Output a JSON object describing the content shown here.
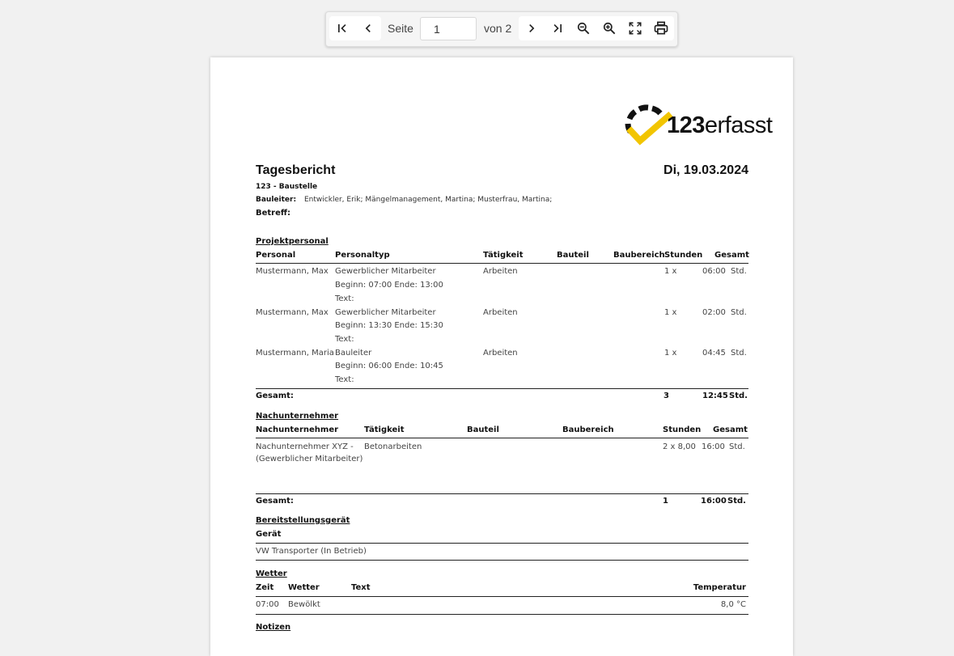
{
  "toolbar": {
    "page_label": "Seite",
    "page_value": "1",
    "of_label": "von 2",
    "icons": [
      "first-page-icon",
      "prev-page-icon",
      "next-page-icon",
      "last-page-icon",
      "zoom-out-icon",
      "zoom-in-icon",
      "fullscreen-icon",
      "print-icon"
    ]
  },
  "report": {
    "logo_text_bold": "123",
    "logo_text_rest": "erfasst",
    "logo_colors": {
      "ring": "#111111",
      "check": "#f2c500"
    },
    "title": "Tagesbericht",
    "date": "Di, 19.03.2024",
    "site": "123 - Baustelle",
    "manager_label": "Bauleiter:",
    "manager_value": "Entwickler, Erik; Mängelmanagement, Martina; Musterfrau, Martina;",
    "subject_label": "Betreff:"
  },
  "personnel": {
    "section": "Projektpersonal",
    "headers": {
      "name": "Personal",
      "type": "Personaltyp",
      "activity": "Tätigkeit",
      "part": "Bauteil",
      "area": "Baubereich",
      "hours": "Stunden",
      "total": "Gesamt"
    },
    "rows": [
      {
        "name": "Mustermann, Max",
        "type": "Gewerblicher Mitarbeiter",
        "time": "Beginn: 07:00 Ende: 13:00",
        "text": "Text:",
        "activity": "Arbeiten",
        "count": "1 x",
        "total": "06:00",
        "unit": "Std."
      },
      {
        "name": "Mustermann, Max",
        "type": "Gewerblicher Mitarbeiter",
        "time": "Beginn: 13:30 Ende: 15:30",
        "text": "Text:",
        "activity": "Arbeiten",
        "count": "1 x",
        "total": "02:00",
        "unit": "Std."
      },
      {
        "name": "Mustermann, Maria",
        "type": "Bauleiter",
        "time": "Beginn: 06:00 Ende: 10:45",
        "text": "Text:",
        "activity": "Arbeiten",
        "count": "1 x",
        "total": "04:45",
        "unit": "Std."
      }
    ],
    "total_label": "Gesamt:",
    "total_count": "3",
    "total_hours": "12:45",
    "total_unit": "Std."
  },
  "subcontractors": {
    "section": "Nachunternehmer",
    "headers": {
      "name": "Nachunternehmer",
      "activity": "Tätigkeit",
      "part": "Bauteil",
      "area": "Baubereich",
      "hours": "Stunden",
      "total": "Gesamt"
    },
    "rows": [
      {
        "name_line1": "Nachunternehmer XYZ -",
        "name_line2": "(Gewerblicher Mitarbeiter)",
        "activity": "Betonarbeiten",
        "hours": "2 x 8,00",
        "total": "16:00",
        "unit": "Std."
      }
    ],
    "total_label": "Gesamt:",
    "total_count": "1",
    "total_hours": "16:00",
    "total_unit": "Std."
  },
  "equipment": {
    "section": "Bereitstellungsgerät",
    "header": "Gerät",
    "rows": [
      "VW Transporter (In Betrieb)"
    ]
  },
  "weather": {
    "section": "Wetter",
    "headers": {
      "time": "Zeit",
      "weather": "Wetter",
      "text": "Text",
      "temperature": "Temperatur"
    },
    "rows": [
      {
        "time": "07:00",
        "weather": "Bewölkt",
        "text": "",
        "temperature": "8,0 °C"
      }
    ]
  },
  "notes": {
    "section": "Notizen"
  }
}
